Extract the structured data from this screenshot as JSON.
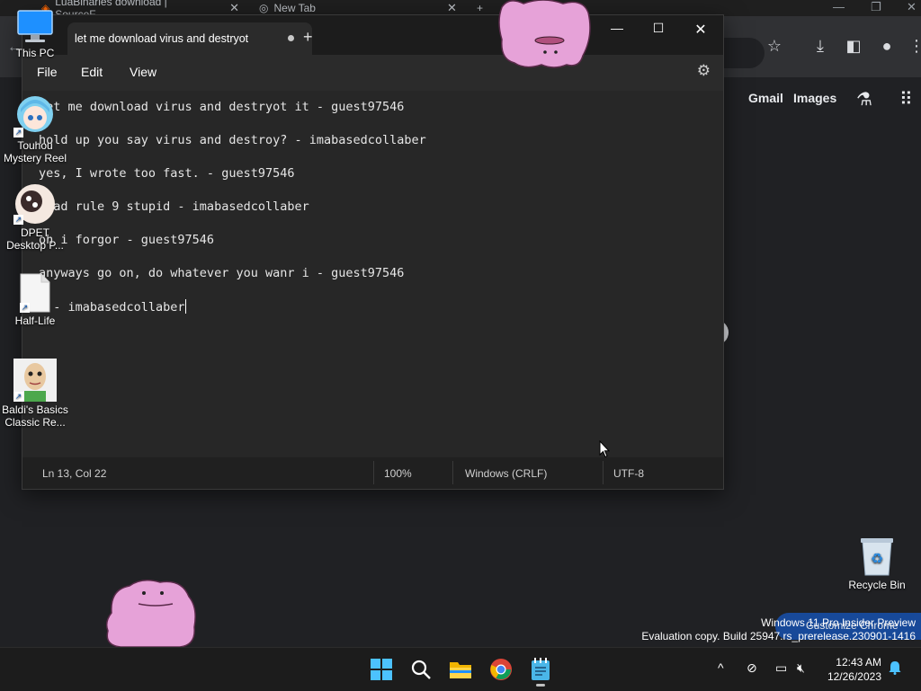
{
  "chrome": {
    "tabs": [
      {
        "title": "LuaBinaries download | SourceF"
      },
      {
        "title": "New Tab"
      }
    ],
    "new_tab_symbol": "+",
    "toolbar_icons": [
      "star-icon",
      "download-icon",
      "sidepanel-icon",
      "profile-icon",
      "more-menu-icon"
    ],
    "links": {
      "gmail": "Gmail",
      "images": "Images"
    },
    "customize_label": "Customize Chrome"
  },
  "notepad": {
    "tab_title": "let me download virus and destryot",
    "menu": [
      "File",
      "Edit",
      "View"
    ],
    "lines": [
      "let me download virus and destryot it - guest97546",
      "hold up you say virus and destroy? - imabasedcollaber",
      "yes, I wrote too fast. - guest97546",
      "read rule 9 stupid - imabasedcollaber",
      "oh i forgor - guest97546",
      "anyways go on, do whatever you wanr i - guest97546",
      "k - imabasedcollaber"
    ],
    "status": {
      "position": "Ln 13, Col 22",
      "zoom": "100%",
      "line_ending": "Windows (CRLF)",
      "encoding": "UTF-8"
    }
  },
  "desktop": {
    "icons": [
      {
        "label": "This PC",
        "icon": "computer-icon"
      },
      {
        "label": "Touhou Mystery Reel",
        "icon": "anime-character-icon"
      },
      {
        "label": "DPET Desktop P...",
        "icon": "dpet-icon"
      },
      {
        "label": "Half-Life",
        "icon": "blank-file-icon"
      },
      {
        "label": "Baldi's Basics Classic Re...",
        "icon": "baldi-icon"
      },
      {
        "label": "Recycle Bin",
        "icon": "recycle-bin-icon"
      }
    ]
  },
  "watermark": {
    "line1": "Windows 11 Pro Insider Preview",
    "line2": "Evaluation copy. Build 25947.rs_prerelease.230901-1416"
  },
  "taskbar": {
    "apps": [
      "start-icon",
      "search-icon",
      "file-explorer-icon",
      "chrome-icon",
      "notepad-icon"
    ],
    "tray": {
      "chevron": "^"
    },
    "time": "12:43 AM",
    "date": "12/26/2023"
  },
  "colors": {
    "accent": "#0078d4",
    "ditto_pink": "#e8a3d6",
    "chrome_bg": "#202124",
    "notepad_editor": "#272727"
  }
}
